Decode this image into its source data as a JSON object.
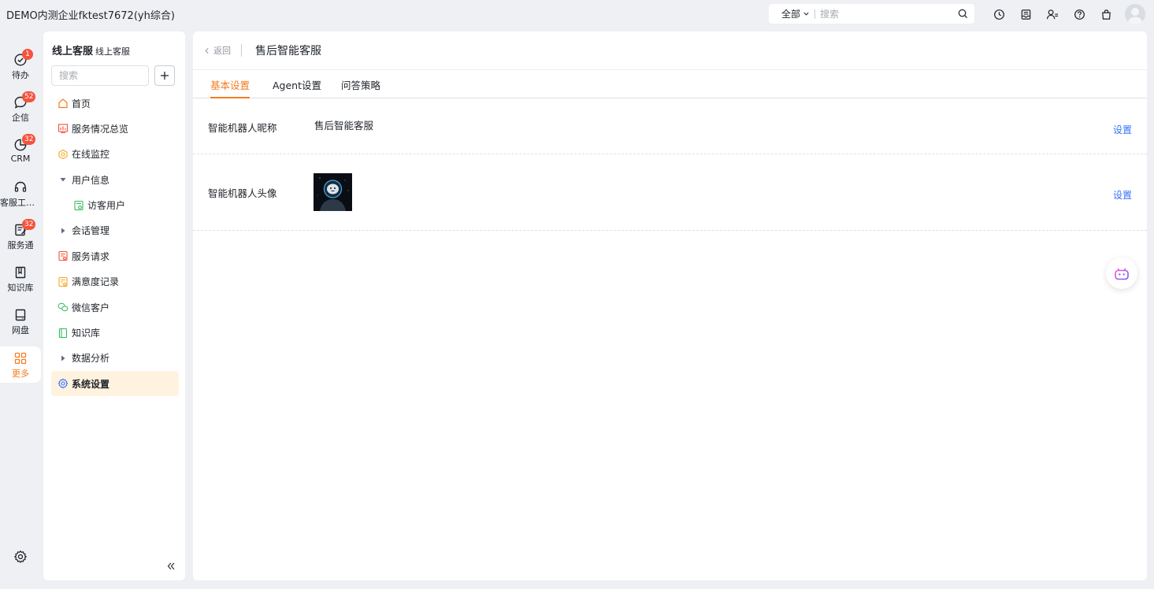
{
  "topbar": {
    "company": "DEMO内测企业fktest7672(yh综合)",
    "search_scope": "全部",
    "search_placeholder": "搜索",
    "icons": [
      "clock-icon",
      "inbox-icon",
      "contacts-icon",
      "help-icon",
      "bag-icon"
    ]
  },
  "rail": {
    "items": [
      {
        "label": "待办",
        "badge": "1",
        "icon": "check-circle-icon"
      },
      {
        "label": "企信",
        "badge": "52",
        "icon": "chat-bubble-icon"
      },
      {
        "label": "CRM",
        "badge": "32",
        "icon": "pie-icon"
      },
      {
        "label": "客服工作台",
        "badge": "",
        "icon": "headset-icon"
      },
      {
        "label": "服务通",
        "badge": "32",
        "icon": "clipboard-icon"
      },
      {
        "label": "知识库",
        "badge": "",
        "icon": "book-icon"
      },
      {
        "label": "网盘",
        "badge": "",
        "icon": "disk-icon"
      },
      {
        "label": "更多",
        "badge": "",
        "icon": "grid-icon"
      }
    ],
    "active_color": "#f57c1f"
  },
  "sidebar": {
    "title": "线上客服",
    "subtitle": "线上客服",
    "search_placeholder": "搜索",
    "items": [
      {
        "label": "首页",
        "icon": "home-icon"
      },
      {
        "label": "服务情况总览",
        "icon": "chart-icon"
      },
      {
        "label": "在线监控",
        "icon": "monitor-icon"
      },
      {
        "label": "用户信息",
        "icon": "caret-down-icon"
      },
      {
        "label": "访客用户",
        "icon": "visitor-icon"
      },
      {
        "label": "会话管理",
        "icon": "caret-right-icon"
      },
      {
        "label": "服务请求",
        "icon": "request-icon"
      },
      {
        "label": "满意度记录",
        "icon": "satisfaction-icon"
      },
      {
        "label": "微信客户",
        "icon": "wechat-icon"
      },
      {
        "label": "知识库",
        "icon": "kb-icon"
      },
      {
        "label": "数据分析",
        "icon": "caret-right-icon"
      },
      {
        "label": "系统设置",
        "icon": "gear-icon"
      }
    ]
  },
  "main": {
    "back_label": "返回",
    "title": "售后智能客服",
    "tabs": [
      {
        "label": "基本设置",
        "active": true
      },
      {
        "label": "Agent设置",
        "active": false
      },
      {
        "label": "问答策略",
        "active": false
      }
    ],
    "rows": [
      {
        "label": "智能机器人昵称",
        "value": "售后智能客服",
        "action": "设置"
      },
      {
        "label": "智能机器人头像",
        "value": "",
        "action": "设置"
      }
    ]
  },
  "colors": {
    "accent": "#f57c1f",
    "link": "#3370ff",
    "badge": "#f5533d"
  }
}
